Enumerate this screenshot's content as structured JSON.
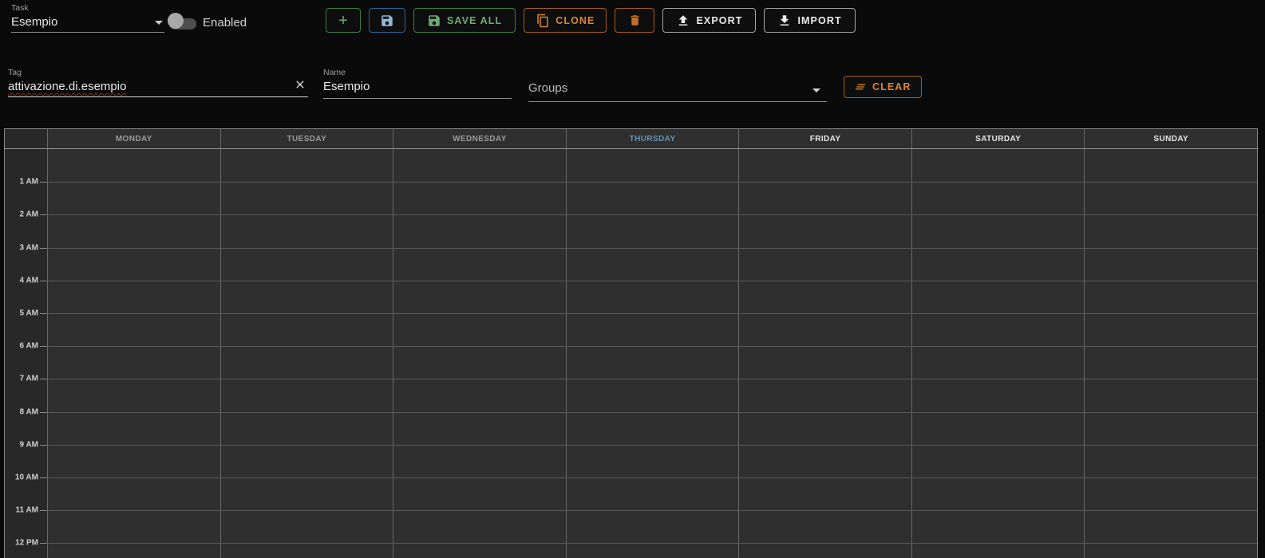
{
  "task": {
    "label": "Task",
    "value": "Esempio",
    "enabled_label": "Enabled"
  },
  "toolbar": {
    "add_label": "+",
    "save_all_label": "SAVE ALL",
    "clone_label": "CLONE",
    "export_label": "EXPORT",
    "import_label": "IMPORT"
  },
  "fields": {
    "tag": {
      "label": "Tag",
      "value": "attivazione.di.esempio"
    },
    "name": {
      "label": "Name",
      "value": "Esempio"
    },
    "groups": {
      "label": "Groups",
      "value": ""
    },
    "clear_label": "CLEAR"
  },
  "calendar": {
    "days": [
      {
        "label": "MONDAY",
        "state": "past"
      },
      {
        "label": "TUESDAY",
        "state": "past"
      },
      {
        "label": "WEDNESDAY",
        "state": "past"
      },
      {
        "label": "THURSDAY",
        "state": "today"
      },
      {
        "label": "FRIDAY",
        "state": "future"
      },
      {
        "label": "SATURDAY",
        "state": "future"
      },
      {
        "label": "SUNDAY",
        "state": "future"
      }
    ],
    "hours": [
      "1 AM",
      "2 AM",
      "3 AM",
      "4 AM",
      "5 AM",
      "6 AM",
      "7 AM",
      "8 AM",
      "9 AM",
      "10 AM",
      "11 AM",
      "12 PM"
    ]
  },
  "colors": {
    "accent_green": "#6cab74",
    "accent_blue": "#92b8d9",
    "accent_orange": "#d8862f",
    "today_blue": "#6593b5",
    "background": "#0a0a0a",
    "grid_background": "#2f2f2f"
  }
}
